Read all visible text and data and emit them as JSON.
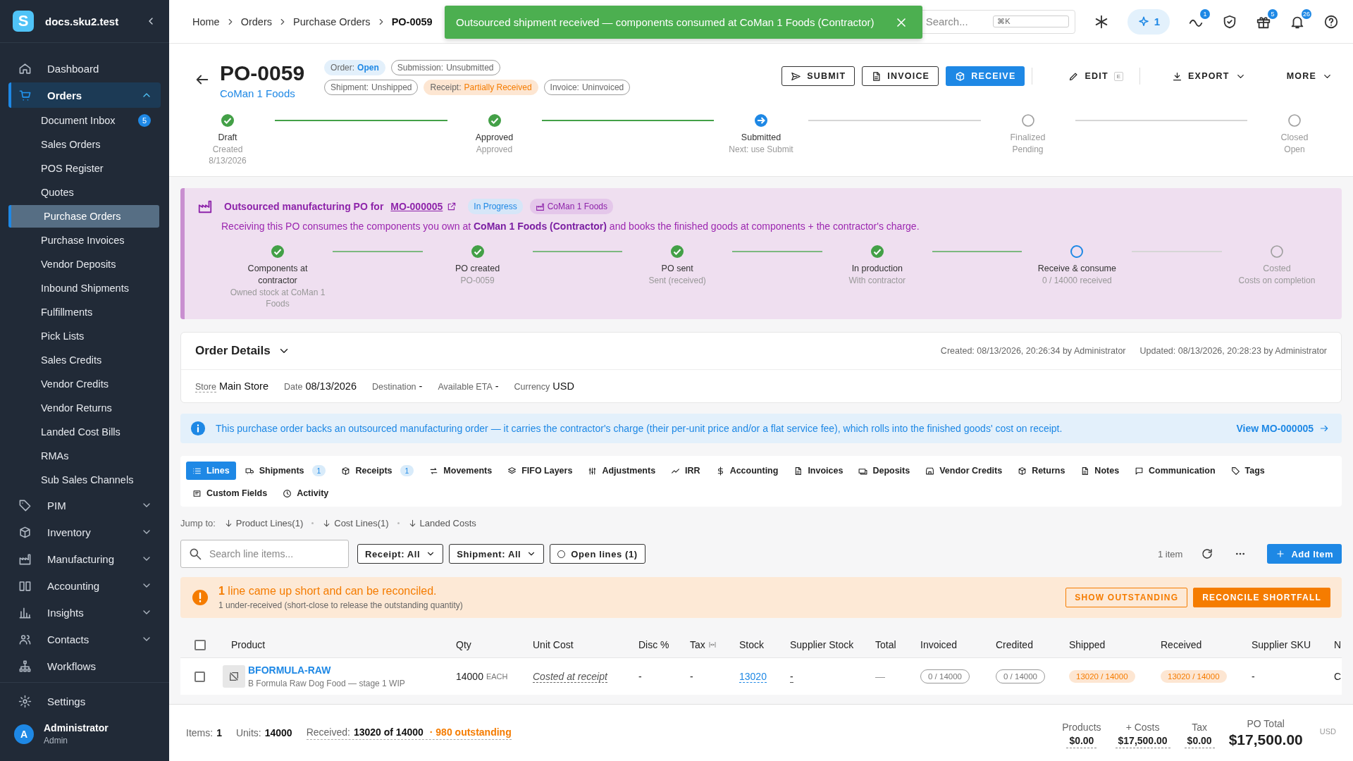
{
  "sidebar": {
    "brand": "docs.sku2.test",
    "logo": "S",
    "items": [
      {
        "label": "Dashboard",
        "selected": false
      },
      {
        "label": "Orders",
        "selected": true,
        "expanded": true,
        "children": [
          {
            "label": "Document Inbox",
            "badge": "5",
            "selected": false
          },
          {
            "label": "Sales Orders",
            "selected": false
          },
          {
            "label": "POS Register",
            "selected": false
          },
          {
            "label": "Quotes",
            "selected": false
          },
          {
            "label": "Purchase Orders",
            "selected": true
          },
          {
            "label": "Purchase Invoices",
            "selected": false
          },
          {
            "label": "Vendor Deposits",
            "selected": false
          },
          {
            "label": "Inbound Shipments",
            "selected": false
          },
          {
            "label": "Fulfillments",
            "selected": false
          },
          {
            "label": "Pick Lists",
            "selected": false
          },
          {
            "label": "Sales Credits",
            "selected": false
          },
          {
            "label": "Vendor Credits",
            "selected": false
          },
          {
            "label": "Vendor Returns",
            "selected": false
          },
          {
            "label": "Landed Cost Bills",
            "selected": false
          },
          {
            "label": "RMAs",
            "selected": false
          },
          {
            "label": "Sub Sales Channels",
            "selected": false
          }
        ]
      },
      {
        "label": "PIM",
        "selected": false,
        "expanded": false
      },
      {
        "label": "Inventory",
        "selected": false,
        "expanded": false
      },
      {
        "label": "Manufacturing",
        "selected": false,
        "expanded": false
      },
      {
        "label": "Accounting",
        "selected": false,
        "expanded": false
      },
      {
        "label": "Insights",
        "selected": false,
        "expanded": false
      },
      {
        "label": "Contacts",
        "selected": false,
        "expanded": false
      },
      {
        "label": "Workflows",
        "selected": false
      }
    ],
    "settings": "Settings",
    "user": {
      "initial": "A",
      "name": "Administrator",
      "role": "Admin"
    }
  },
  "topbar": {
    "breadcrumbs": [
      "Home",
      "Orders",
      "Purchase Orders",
      "PO-0059"
    ],
    "search": {
      "placeholder": "Search...",
      "shortcut": "⌘K"
    },
    "ai_count": "1",
    "badges": {
      "activity": "1",
      "gifts": "5",
      "notifications": "26"
    }
  },
  "toast": {
    "text": "Outsourced shipment received — components consumed at CoMan 1 Foods (Contractor)"
  },
  "order": {
    "number": "PO-0059",
    "vendor": "CoMan 1 Foods",
    "chip_rows": [
      [
        {
          "label": "Order:",
          "value": "Open",
          "kind": "info"
        },
        {
          "label": "Submission:",
          "value": "Unsubmitted",
          "kind": "plain"
        }
      ],
      [
        {
          "label": "Shipment:",
          "value": "Unshipped",
          "kind": "plain"
        },
        {
          "label": "Receipt:",
          "value": "Partially Received",
          "kind": "warning"
        },
        {
          "label": "Invoice:",
          "value": "Uninvoiced",
          "kind": "plain"
        }
      ]
    ],
    "actions": [
      {
        "label": "SUBMIT",
        "kind": "outline"
      },
      {
        "label": "INVOICE",
        "kind": "outline"
      },
      {
        "label": "RECEIVE",
        "kind": "primary"
      },
      {
        "label": "EDIT",
        "shortcut": "E",
        "kind": "text"
      },
      {
        "label": "EXPORT",
        "kind": "menu"
      },
      {
        "label": "MORE",
        "kind": "menu"
      }
    ]
  },
  "progress": [
    {
      "label": "Draft",
      "lines": [
        "Created",
        "8/13/2026"
      ],
      "done": true,
      "current": false
    },
    {
      "label": "Approved",
      "lines": [
        "Approved"
      ],
      "done": true,
      "current": false
    },
    {
      "label": "Submitted",
      "lines": [
        "Next: use Submit"
      ],
      "done": false,
      "current": true
    },
    {
      "label": "Finalized",
      "lines": [
        "Pending"
      ],
      "done": false,
      "current": false
    },
    {
      "label": "Closed",
      "lines": [
        "Open"
      ],
      "done": false,
      "current": false
    }
  ],
  "outsourcing": {
    "title": "Outsourced manufacturing PO for",
    "link": "MO-000005",
    "status": "In Progress",
    "contractor": "CoMan 1 Foods",
    "description": "Receiving this PO consumes the components you own at **CoMan 1 Foods (Contractor)** and books the finished goods at components + the contractor's charge.",
    "steps": [
      {
        "label": "Components at contractor",
        "lines": [
          "Owned stock at CoMan 1 Foods"
        ],
        "done": true,
        "current": false
      },
      {
        "label": "PO created",
        "lines": [
          "PO-0059"
        ],
        "done": true,
        "current": false
      },
      {
        "label": "PO sent",
        "lines": [
          "Sent (received)"
        ],
        "done": true,
        "current": false
      },
      {
        "label": "In production",
        "lines": [
          "With contractor"
        ],
        "done": true,
        "current": false
      },
      {
        "label": "Receive & consume",
        "lines": [
          "0 / 14000 received"
        ],
        "done": false,
        "current": true
      },
      {
        "label": "Costed",
        "lines": [
          "Costs on completion"
        ],
        "done": false,
        "current": false
      }
    ]
  },
  "details": {
    "title": "Order Details",
    "expanded": true,
    "created": "Created: 08/13/2026, 20:26:34 by Administrator",
    "updated": "Updated: 08/13/2026, 20:28:23 by Administrator",
    "fields": [
      {
        "label": "Store",
        "value": "Main Store"
      },
      {
        "label": "Date",
        "value": "08/13/2026"
      },
      {
        "label": "Destination",
        "value": "-"
      },
      {
        "label": "Available ETA",
        "value": "-"
      },
      {
        "label": "Currency",
        "value": "USD"
      }
    ]
  },
  "info": {
    "text": "This purchase order backs an outsourced manufacturing order — it carries the contractor's charge (their per-unit price and/or a flat service fee), which rolls into the finished goods' cost on receipt.",
    "link": "View MO-000005"
  },
  "tabs": [
    {
      "label": "Lines",
      "selected": true
    },
    {
      "label": "Shipments",
      "count": "1",
      "selected": false
    },
    {
      "label": "Receipts",
      "count": "1",
      "selected": false
    },
    {
      "label": "Movements",
      "selected": false
    },
    {
      "label": "FIFO Layers",
      "selected": false
    },
    {
      "label": "Adjustments",
      "selected": false
    },
    {
      "label": "IRR",
      "selected": false
    },
    {
      "label": "Accounting",
      "selected": false
    },
    {
      "label": "Invoices",
      "selected": false
    },
    {
      "label": "Deposits",
      "selected": false
    },
    {
      "label": "Vendor Credits",
      "selected": false
    },
    {
      "label": "Returns",
      "selected": false
    },
    {
      "label": "Notes",
      "selected": false
    },
    {
      "label": "Communication",
      "selected": false
    },
    {
      "label": "Tags",
      "selected": false
    },
    {
      "label": "Custom Fields",
      "selected": false
    },
    {
      "label": "Activity",
      "selected": false
    }
  ],
  "jump": {
    "label": "Jump to:",
    "links": [
      "Product Lines(1)",
      "Cost Lines(1)",
      "Landed Costs"
    ]
  },
  "toolbar": {
    "search_placeholder": "Search line items...",
    "filters": [
      {
        "label": "Receipt: All",
        "kind": "dropdown"
      },
      {
        "label": "Shipment: All",
        "kind": "dropdown"
      },
      {
        "label": "Open lines (1)",
        "kind": "toggle",
        "on": false
      }
    ],
    "count": "1 item",
    "add": "Add Item"
  },
  "alert": {
    "title": "**1** line came up short and can be reconciled.",
    "detail": "1 under-received (short-close to release the outstanding quantity)",
    "actions": [
      {
        "label": "SHOW OUTSTANDING",
        "kind": "outline"
      },
      {
        "label": "RECONCILE SHORTFALL",
        "kind": "primary"
      }
    ]
  },
  "table": {
    "all_checked": false,
    "columns": [
      "Product",
      "Qty",
      "Unit Cost",
      "Disc %",
      "Tax",
      "Stock",
      "Supplier Stock",
      "Total",
      "Invoiced",
      "Credited",
      "Shipped",
      "Received",
      "Supplier SKU",
      "N"
    ],
    "rows": [
      {
        "checked": false,
        "sku": "BFORMULA-RAW",
        "description": "B Formula Raw Dog Food — stage 1 WIP",
        "qty": "14000",
        "unit": "EACH",
        "unit_cost": "Costed at receipt",
        "disc": "-",
        "tax": "-",
        "stock": "13020",
        "supplier_stock": "-",
        "total": "—",
        "invoiced": "0 / 14000",
        "credited": "0 / 14000",
        "shipped": "13020 / 14000",
        "received": "13020 / 14000",
        "supplier_sku": "-",
        "column_14": "C"
      }
    ]
  },
  "footer": {
    "items": {
      "label": "Items:",
      "value": "1"
    },
    "units": {
      "label": "Units:",
      "value": "14000"
    },
    "received": {
      "label": "Received:",
      "value": "13020 of 14000",
      "note": "· 980 outstanding"
    },
    "totals": [
      {
        "label": "Products",
        "value": "$0.00"
      },
      {
        "label": "+ Costs",
        "value": "$17,500.00"
      },
      {
        "label": "Tax",
        "value": "$0.00"
      }
    ],
    "grand": {
      "label": "PO Total",
      "value": "$17,500.00",
      "currency": "USD"
    }
  }
}
